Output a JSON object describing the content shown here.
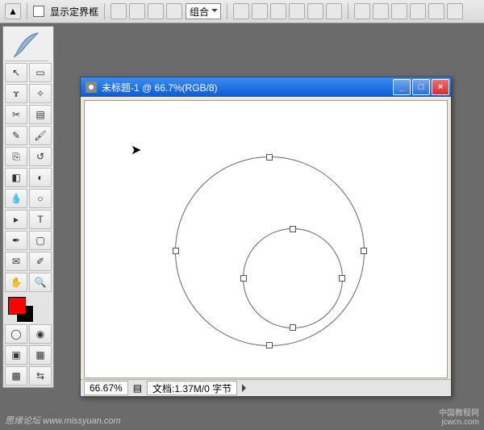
{
  "topbar": {
    "show_bounds_label": "显示定界框",
    "combo_label": "组合"
  },
  "window": {
    "title": "未标题-1 @ 66.7%(RGB/8)",
    "minimize": "_",
    "maximize": "□",
    "close": "×"
  },
  "status": {
    "zoom": "66.67%",
    "doc": "文档:1.37M/0 字节"
  },
  "watermark": {
    "left": "思缘论坛 www.missyuan.com",
    "right_top": "中国教程网",
    "right_bottom": "jcwcn.com"
  },
  "colors": {
    "foreground": "#ff0000",
    "background": "#000000"
  },
  "tools": [
    "selection-tool",
    "marquee-tool",
    "lasso-tool",
    "wand-tool",
    "crop-tool",
    "slice-tool",
    "healing-tool",
    "brush-tool",
    "clone-tool",
    "history-brush-tool",
    "eraser-tool",
    "gradient-tool",
    "blur-tool",
    "dodge-tool",
    "path-select-tool",
    "type-tool",
    "pen-tool",
    "shape-tool",
    "notes-tool",
    "eyedropper-tool",
    "hand-tool",
    "zoom-tool"
  ]
}
